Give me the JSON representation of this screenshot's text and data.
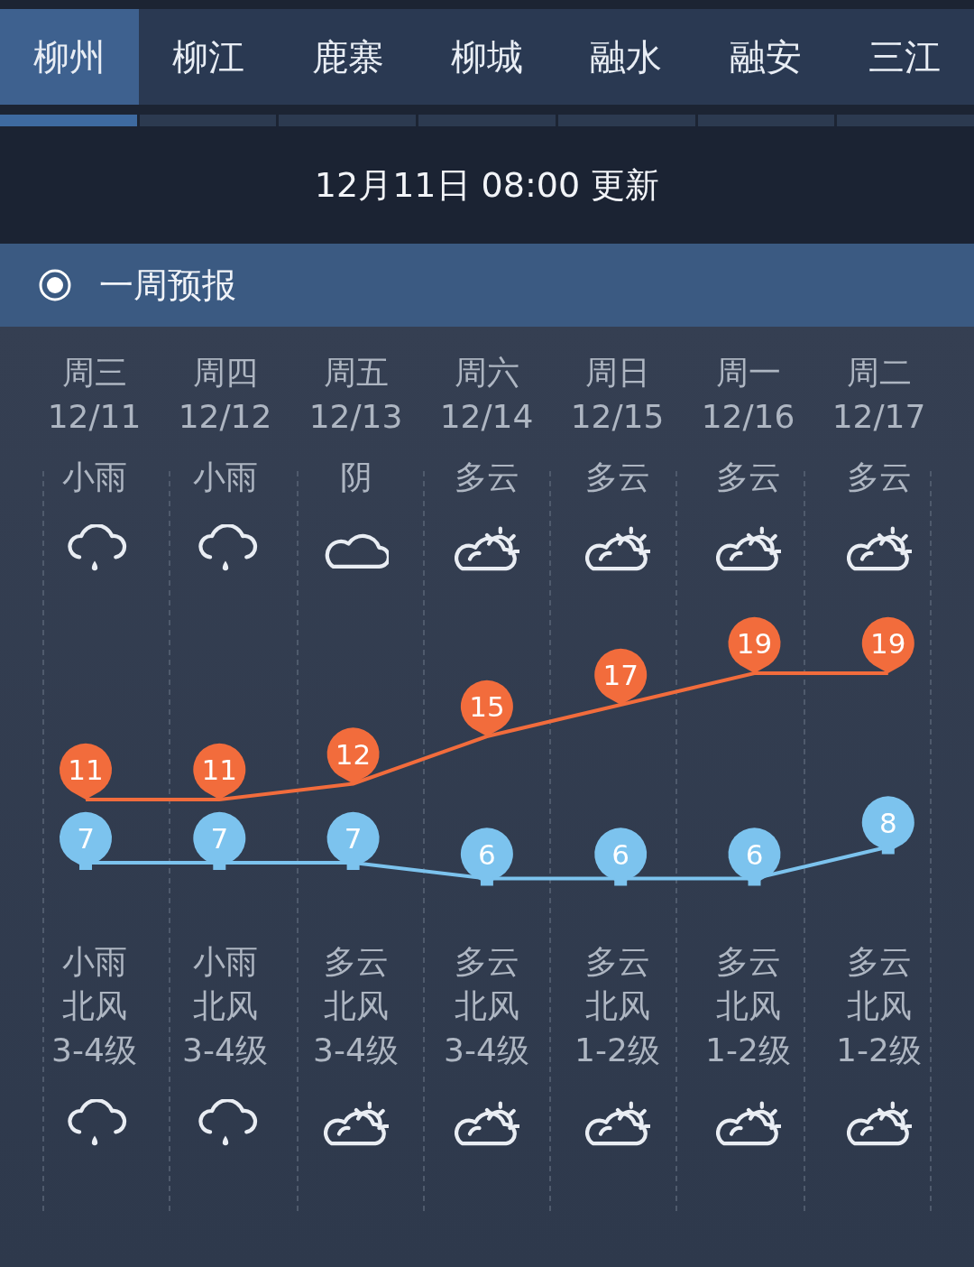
{
  "tabs": [
    {
      "label": "柳州",
      "selected": true
    },
    {
      "label": "柳江",
      "selected": false
    },
    {
      "label": "鹿寨",
      "selected": false
    },
    {
      "label": "柳城",
      "selected": false
    },
    {
      "label": "融水",
      "selected": false
    },
    {
      "label": "融安",
      "selected": false
    },
    {
      "label": "三江",
      "selected": false
    }
  ],
  "update_text": "12月11日 08:00 更新",
  "section_title": "一周预报",
  "days": [
    {
      "weekday": "周三",
      "date": "12/11",
      "day_weather": "小雨",
      "day_icon": {
        "kind": "rain"
      },
      "night_weather": "小雨",
      "wind": "北风",
      "wind_level": "3-4级",
      "night_icon": {
        "kind": "rain"
      }
    },
    {
      "weekday": "周四",
      "date": "12/12",
      "day_weather": "小雨",
      "day_icon": {
        "kind": "rain"
      },
      "night_weather": "小雨",
      "wind": "北风",
      "wind_level": "3-4级",
      "night_icon": {
        "kind": "rain"
      }
    },
    {
      "weekday": "周五",
      "date": "12/13",
      "day_weather": "阴",
      "day_icon": {
        "kind": "cloud"
      },
      "night_weather": "多云",
      "wind": "北风",
      "wind_level": "3-4级",
      "night_icon": {
        "kind": "partly"
      }
    },
    {
      "weekday": "周六",
      "date": "12/14",
      "day_weather": "多云",
      "day_icon": {
        "kind": "partly"
      },
      "night_weather": "多云",
      "wind": "北风",
      "wind_level": "3-4级",
      "night_icon": {
        "kind": "partly"
      }
    },
    {
      "weekday": "周日",
      "date": "12/15",
      "day_weather": "多云",
      "day_icon": {
        "kind": "partly"
      },
      "night_weather": "多云",
      "wind": "北风",
      "wind_level": "1-2级",
      "night_icon": {
        "kind": "partly"
      }
    },
    {
      "weekday": "周一",
      "date": "12/16",
      "day_weather": "多云",
      "day_icon": {
        "kind": "partly"
      },
      "night_weather": "多云",
      "wind": "北风",
      "wind_level": "1-2级",
      "night_icon": {
        "kind": "partly"
      }
    },
    {
      "weekday": "周二",
      "date": "12/17",
      "day_weather": "多云",
      "day_icon": {
        "kind": "partly"
      },
      "night_weather": "多云",
      "wind": "北风",
      "wind_level": "1-2级",
      "night_icon": {
        "kind": "partly"
      }
    }
  ],
  "chart_data": {
    "type": "line",
    "series": [
      {
        "color": "#f26c3c",
        "values": [
          11,
          11,
          12,
          15,
          17,
          19,
          19
        ]
      },
      {
        "color": "#7cc3ee",
        "values": [
          7,
          7,
          7,
          6,
          6,
          6,
          8
        ]
      }
    ],
    "data_labels": true
  }
}
